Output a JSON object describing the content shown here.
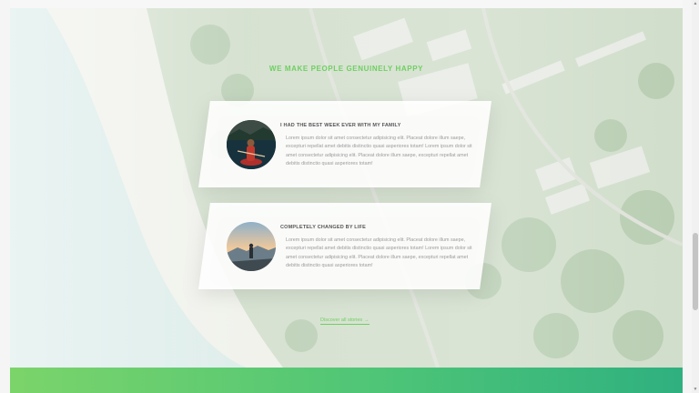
{
  "section": {
    "title": "WE MAKE PEOPLE GENUINELY HAPPY"
  },
  "stories": [
    {
      "title": "I HAD THE BEST WEEK EVER WITH MY FAMILY",
      "body": "Lorem ipsum dolor sit amet consectetur adipisicing elit. Placeat dolore illum saepe, excepturi repellat amet debitis distinctio quasi asperiores totam! Lorem ipsum dolor sit amet consectetur adipisicing elit. Placeat dolore illum saepe, excepturi repellat amet debitis distinctio quasi asperiores totam!"
    },
    {
      "title": "COMPLETELY CHANGED BY LIFE",
      "body": "Lorem ipsum dolor sit amet consectetur adipisicing elit. Placeat dolore illum saepe, excepturi repellat amet debitis distinctio quasi asperiores totam! Lorem ipsum dolor sit amet consectetur adipisicing elit. Placeat dolore illum saepe, excepturi repellat amet debitis distinctio quasi asperiores totam!"
    }
  ],
  "discover": {
    "label": "Discover all stories",
    "arrow": "→"
  },
  "colors": {
    "accent": "#6fcf62",
    "footer_gradient_start": "#7bd46a",
    "footer_gradient_end": "#2fb07f"
  },
  "scrollbar": {
    "up_icon": "▲",
    "down_icon": "▼"
  }
}
